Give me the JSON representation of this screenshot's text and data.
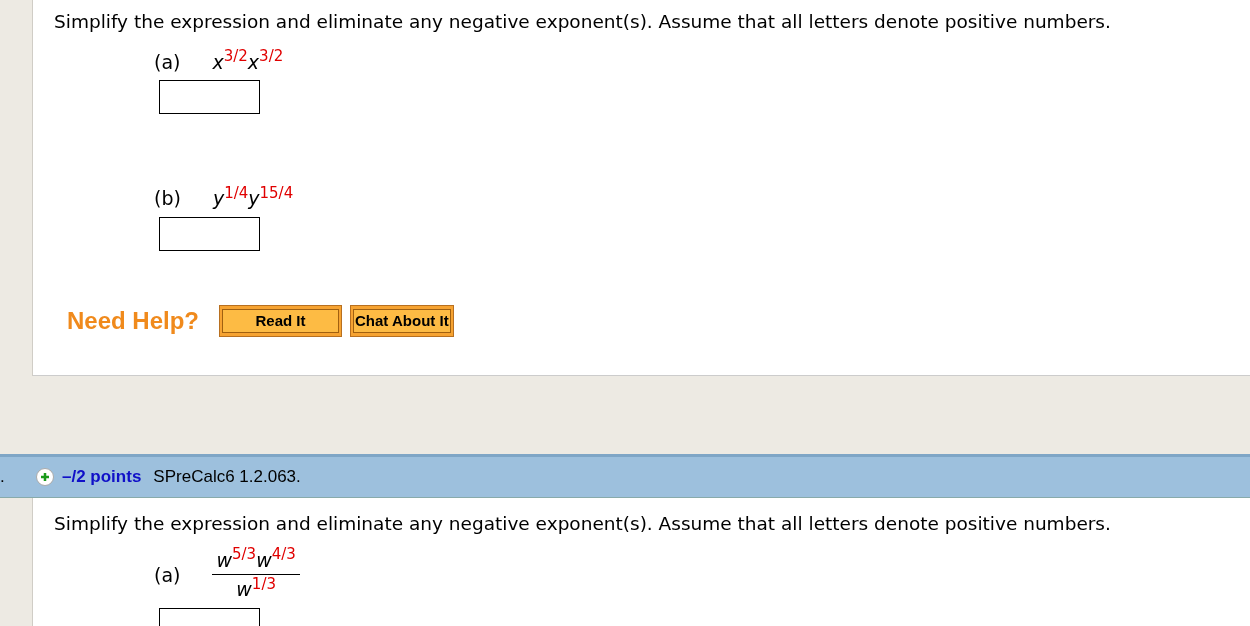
{
  "questions": [
    {
      "instruction": "Simplify the expression and eliminate any negative exponent(s). Assume that all letters denote positive numbers.",
      "parts": [
        {
          "label": "(a)",
          "kind": "product",
          "numerator": [
            {
              "base": "x",
              "exp": "3/2"
            },
            {
              "base": "x",
              "exp": "3/2"
            }
          ]
        },
        {
          "label": "(b)",
          "kind": "product",
          "numerator": [
            {
              "base": "y",
              "exp": "1/4"
            },
            {
              "base": "y",
              "exp": "15/4"
            }
          ]
        }
      ],
      "help": {
        "label": "Need Help?",
        "buttons": [
          "Read It",
          "Chat About It"
        ]
      }
    },
    {
      "header": {
        "number": ".",
        "points": "–/2 points",
        "source": "SPreCalc6 1.2.063."
      },
      "instruction": "Simplify the expression and eliminate any negative exponent(s). Assume that all letters denote positive numbers.",
      "parts": [
        {
          "label": "(a)",
          "kind": "fraction",
          "numerator": [
            {
              "base": "w",
              "exp": "5/3"
            },
            {
              "base": "w",
              "exp": "4/3"
            }
          ],
          "denominator": [
            {
              "base": "w",
              "exp": "1/3"
            }
          ]
        }
      ]
    }
  ]
}
